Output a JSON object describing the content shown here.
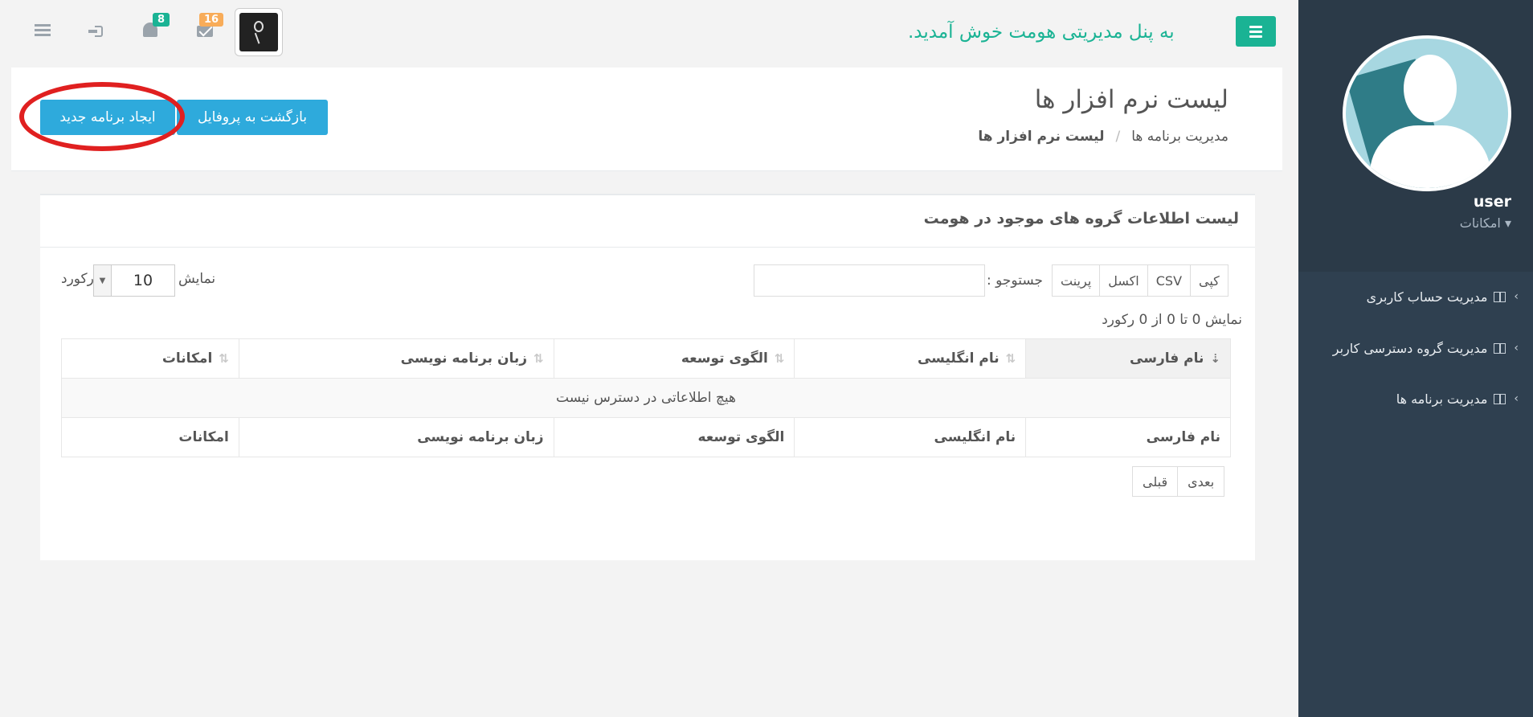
{
  "topbar": {
    "welcome": "به پنل مدیریتی هومت خوش آمدید.",
    "messages_badge": "16",
    "notifications_badge": "8",
    "colors": {
      "accent": "#1ab394",
      "badge_orange": "#f8ac59",
      "badge_green": "#1ab394"
    }
  },
  "sidebar": {
    "username": "user",
    "user_menu": "امکانات ▾",
    "items": [
      {
        "label": "مدیریت حساب کاربری",
        "icon": "columns-icon"
      },
      {
        "label": "مدیریت گروه دسترسی کاربر",
        "icon": "columns-icon"
      },
      {
        "label": "مدیریت برنامه ها",
        "icon": "columns-icon"
      }
    ]
  },
  "heading": {
    "title": "لیست نرم افزار ها",
    "breadcrumb": [
      "مدیریت برنامه ها",
      "لیست نرم افزار ها"
    ],
    "back_button": "بازگشت به پروفایل",
    "new_button": "ایجاد برنامه جدید"
  },
  "ibox": {
    "title": "لیست اطلاعات گروه های موجود در هومت",
    "export_buttons": [
      "کپی",
      "CSV",
      "اکسل",
      "پرینت"
    ],
    "search_label": "جستوجو :",
    "show_label": "نمایش",
    "records_label": "رکورد",
    "page_length": "10",
    "info": "نمایش 0 تا 0 از 0 رکورد",
    "columns": [
      "نام فارسی",
      "نام انگلیسی",
      "الگوی توسعه",
      "زبان برنامه نویسی",
      "امکانات"
    ],
    "empty_message": "هیچ اطلاعاتی در دسترس نیست",
    "pager": {
      "next": "بعدی",
      "prev": "قبلی"
    }
  }
}
